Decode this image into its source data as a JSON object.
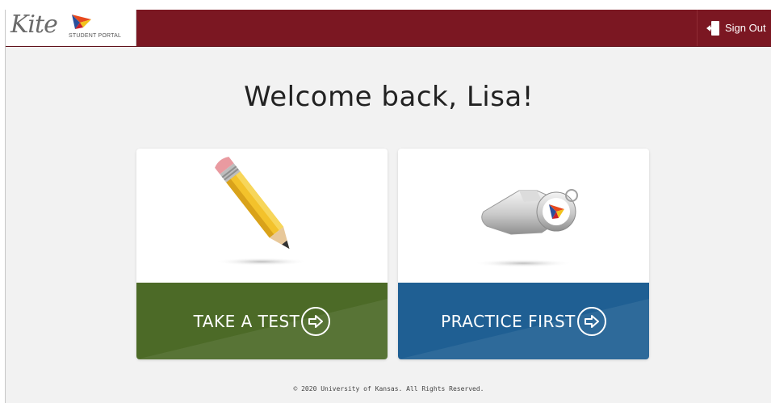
{
  "header": {
    "logo_word": "Kite",
    "logo_subtitle": "STUDENT PORTAL",
    "signout_label": "Sign Out",
    "bar_color": "#7b1722"
  },
  "main": {
    "welcome_text": "Welcome back, Lisa!"
  },
  "cards": [
    {
      "label": "TAKE A TEST",
      "icon": "pencil-icon",
      "band_color": "#4c6a27"
    },
    {
      "label": "PRACTICE FIRST",
      "icon": "whistle-icon",
      "band_color": "#1f5f93"
    }
  ],
  "footer": {
    "copyright": "© 2020 University of Kansas. All Rights Reserved."
  }
}
